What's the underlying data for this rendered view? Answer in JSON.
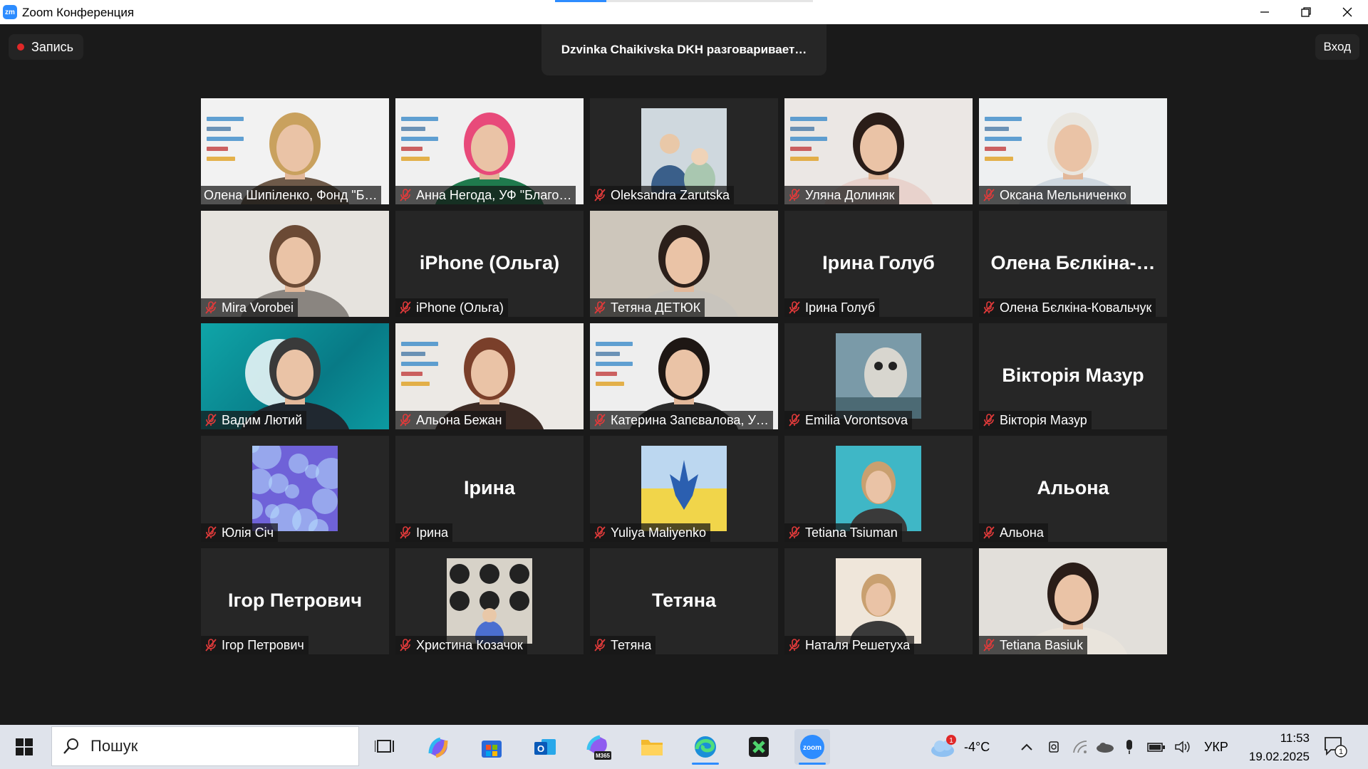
{
  "window": {
    "logo": "zm",
    "title": "Zoom Конференция",
    "progress": 0.2
  },
  "meeting": {
    "recording_label": "Запись",
    "speaker_banner": "Dzvinka Chaikivska DKH разговаривает…",
    "view_label": "Вход"
  },
  "participants": [
    {
      "name": "Олена Шипіленко, Фонд \"Б…",
      "video": true,
      "slides": true,
      "muted": false,
      "hair": "#c9a15e",
      "shirt": "#6e5a49",
      "bg": "#f2f2f2"
    },
    {
      "name": "Анна Негода, УФ \"Благо…",
      "video": true,
      "slides": true,
      "muted": true,
      "hair": "#e84a7a",
      "shirt": "#1f7a4d",
      "bg": "#f0f0f0"
    },
    {
      "name": "Oleksandra Zarutska",
      "thumb": "photo",
      "muted": true,
      "thumb_color": "#cfd8de"
    },
    {
      "name": "Уляна Долиняк",
      "video": true,
      "slides": true,
      "muted": true,
      "hair": "#2a1d18",
      "shirt": "#e8d2cc",
      "bg": "#ebe7e4"
    },
    {
      "name": "Оксана Мельниченко",
      "video": true,
      "slides": true,
      "muted": true,
      "hair": "#e9e6df",
      "shirt": "#cfd8e0",
      "bg": "#eef0f1"
    },
    {
      "name": "Mira Vorobei",
      "video": true,
      "muted": true,
      "hair": "#6b4a35",
      "shirt": "#8a8580",
      "bg": "#e6e3de"
    },
    {
      "name": "iPhone (Ольга)",
      "display": "iPhone (Ольга)",
      "muted": true
    },
    {
      "name": "Тетяна ДЕТЮК",
      "video": true,
      "muted": true,
      "hair": "#2b1f1a",
      "shirt": "#c8c4bd",
      "bg": "#cdc6bb"
    },
    {
      "name": "Ірина Голуб",
      "display": "Ірина Голуб",
      "muted": true
    },
    {
      "name": "Олена Бєлкіна-Ковальчук",
      "display": "Олена Бєлкіна-…",
      "muted": true
    },
    {
      "name": "Вадим Лютий",
      "video": true,
      "teal": true,
      "muted": true,
      "hair": "#3a3a3a",
      "shirt": "#202830",
      "bg": "#0fa5a8"
    },
    {
      "name": "Альона Бежан",
      "video": true,
      "slides": true,
      "muted": true,
      "hair": "#7a3f2a",
      "shirt": "#3b2a24",
      "bg": "#ece9e5"
    },
    {
      "name": "Катерина Запєвалова, У…",
      "video": true,
      "slides": true,
      "muted": true,
      "hair": "#1e1714",
      "shirt": "#2a2a2a",
      "bg": "#eeeeee"
    },
    {
      "name": "Emilia Vorontsova",
      "thumb": "owl",
      "muted": true,
      "thumb_color": "#7a9aa8"
    },
    {
      "name": "Вікторія Мазур",
      "display": "Вікторія Мазур",
      "muted": true
    },
    {
      "name": "Юлія Січ",
      "thumb": "jelly",
      "muted": true,
      "thumb_color": "#6f62d8"
    },
    {
      "name": "Ірина",
      "display": "Ірина",
      "muted": true
    },
    {
      "name": "Yuliya Maliyenko",
      "thumb": "flag",
      "muted": true,
      "thumb_color": "#f1d54a"
    },
    {
      "name": "Tetiana Tsiuman",
      "thumb": "portrait",
      "muted": true,
      "thumb_color": "#3fb7c6"
    },
    {
      "name": "Альона",
      "display": "Альона",
      "muted": true
    },
    {
      "name": "Ігор Петрович",
      "display": "Ігор Петрович",
      "muted": true
    },
    {
      "name": "Христина Козачок",
      "thumb": "records",
      "muted": true,
      "thumb_color": "#d7d2c8"
    },
    {
      "name": "Тетяна",
      "display": "Тетяна",
      "muted": true
    },
    {
      "name": "Наталя Решетуха",
      "thumb": "portrait2",
      "muted": true,
      "thumb_color": "#efe6da"
    },
    {
      "name": "Tetiana Basiuk",
      "video": true,
      "muted": true,
      "hair": "#2a1d18",
      "shirt": "#e9e4dc",
      "bg": "#e2dfda"
    }
  ],
  "taskbar": {
    "search_placeholder": "Пошук",
    "weather_temp": "-4°C",
    "weather_badge": "1",
    "language": "УКР",
    "time": "11:53",
    "date": "19.02.2025",
    "notification_count": "1",
    "m365_label": "M365",
    "zoom_label": "zoom"
  },
  "colors": {
    "accent": "#2d8cff",
    "mute_red": "#e03a3a",
    "tile_bg": "#262626",
    "stage_bg": "#1a1a1a"
  }
}
